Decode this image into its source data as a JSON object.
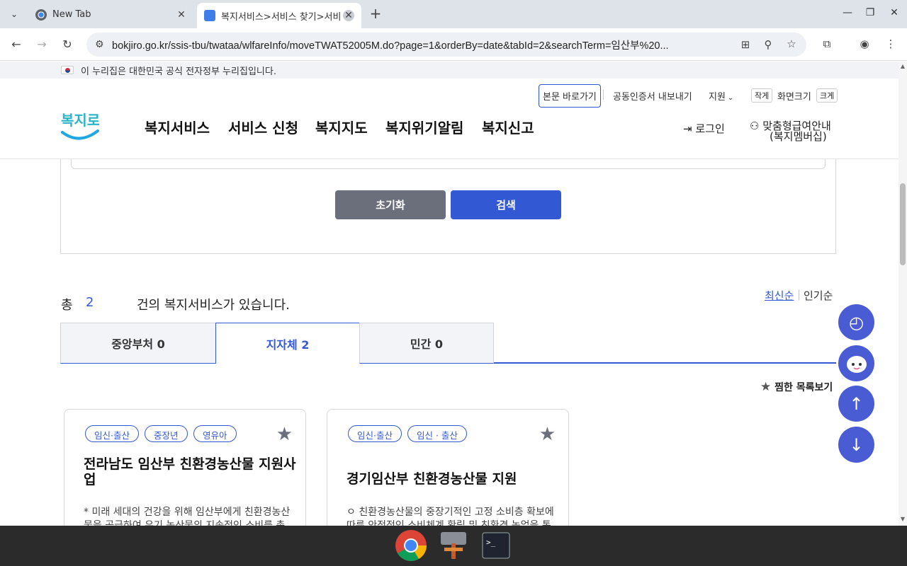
{
  "browser": {
    "tabs": [
      {
        "title": "New Tab",
        "active": false
      },
      {
        "title": "복지서비스>서비스 찾기>서비",
        "active": true
      }
    ],
    "url": "bokjiro.go.kr/ssis-tbu/twataa/wlfareInfo/moveTWAT52005M.do?page=1&orderBy=date&tabId=2&searchTerm=임산부%20..."
  },
  "page": {
    "gov_banner": "이 누리집은 대한민국 공식 전자정부 누리집입니다.",
    "util_links": {
      "skip": "본문 바로가기",
      "cert": "공동인증서 내보내기",
      "region": "지원",
      "small": "작게",
      "screen_size": "화면크기",
      "large": "크게"
    },
    "logo_text": "복지로",
    "main_nav": [
      "복지서비스",
      "서비스 신청",
      "복지지도",
      "복지위기알림",
      "복지신고"
    ],
    "login": "로그인",
    "member_line1": "맞춤형급여안내",
    "member_line2": "(복지멤버십)",
    "buttons": {
      "reset": "초기화",
      "search": "검색"
    },
    "total": {
      "prefix": "총",
      "count": "2",
      "suffix": "건의 복지서비스가 있습니다."
    },
    "sort": {
      "latest": "최신순",
      "popular": "인기순"
    },
    "category_tabs": [
      {
        "label": "중앙부처 0",
        "active": false
      },
      {
        "label": "지자체 2",
        "active": true
      },
      {
        "label": "민간 0",
        "active": false
      }
    ],
    "favorites_link": "찜한 목록보기",
    "cards": [
      {
        "chips": [
          "임신·출산",
          "중장년",
          "영유아"
        ],
        "title": "전라남도 임산부 친환경농산물 지원사업",
        "desc": "* 미래 세대의 건강을 위해 임산부에게 친환경농산물을 공급하여 유기 농산물의 지속적인 소비를 촉진"
      },
      {
        "chips": [
          "임신·출산",
          "임신 · 출산"
        ],
        "title": "경기임산부 친환경농산물 지원",
        "desc": "ㅇ 친환경농산물의 중장기적인 고정 소비층 확보에 따른 안정적인 소비체계 확립 및 친환경 농업을 통한"
      }
    ]
  },
  "colors": {
    "accent": "#3358d4",
    "reset_btn": "#6b6e7b",
    "float_btn": "#4a5cd3"
  }
}
